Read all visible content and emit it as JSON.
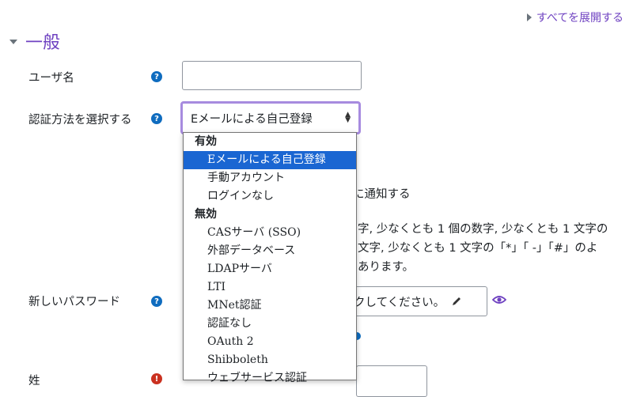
{
  "expand_all_label": "すべてを展開する",
  "section": {
    "title": "一般"
  },
  "fields": {
    "username": {
      "label": "ユーザ名",
      "value": ""
    },
    "auth": {
      "label": "認証方法を選択する",
      "selected": "Eメールによる自己登録"
    },
    "new_password": {
      "label": "新しいパスワード",
      "placeholder_text": "クしてください。"
    },
    "lastname": {
      "label": "姓"
    }
  },
  "behind_text": {
    "notify": "に通知する",
    "policy_line1": "字, 少なくとも 1 個の数字, 少なくとも 1 文字の",
    "policy_line2": "文字, 少なくとも 1 文字の「*」「 -」「#」のよ",
    "policy_line3": "あります。"
  },
  "dropdown": {
    "groups": [
      {
        "label": "有効",
        "items": [
          "Eメールによる自己登録",
          "手動アカウント",
          "ログインなし"
        ]
      },
      {
        "label": "無効",
        "items": [
          "CASサーバ (SSO)",
          "外部データベース",
          "LDAPサーバ",
          "LTI",
          "MNet認証",
          "認証なし",
          "OAuth 2",
          "Shibboleth",
          "ウェブサービス認証"
        ]
      }
    ],
    "selected_item": "Eメールによる自己登録"
  },
  "colors": {
    "accent": "#6f42c1",
    "help": "#0f6cbf",
    "required": "#ca3120",
    "selection": "#1a66d2"
  },
  "icons": {
    "help": "question-circle-icon",
    "required": "exclamation-circle-icon",
    "edit": "pencil-icon",
    "reveal": "eye-icon"
  }
}
